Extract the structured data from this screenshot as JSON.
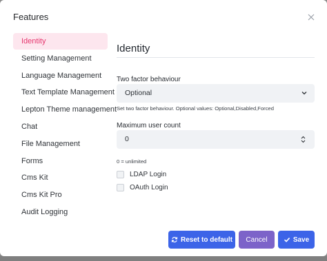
{
  "modal": {
    "title": "Features"
  },
  "nav": {
    "items": [
      {
        "label": "Identity",
        "active": true
      },
      {
        "label": "Setting Management"
      },
      {
        "label": "Language Management"
      },
      {
        "label": "Text Template Management"
      },
      {
        "label": "Lepton Theme management"
      },
      {
        "label": "Chat"
      },
      {
        "label": "File Management"
      },
      {
        "label": "Forms"
      },
      {
        "label": "Cms Kit"
      },
      {
        "label": "Cms Kit Pro"
      },
      {
        "label": "Audit Logging"
      }
    ]
  },
  "section": {
    "title": "Identity",
    "two_factor": {
      "label": "Two factor behaviour",
      "value": "Optional",
      "help": "Set two factor behaviour. Optional values: Optional,Disabled,Forced"
    },
    "max_users": {
      "label": "Maximum user count",
      "value": "0",
      "help": "0 = unlimited"
    },
    "ldap_label": "LDAP Login",
    "oauth_label": "OAuth Login"
  },
  "buttons": {
    "reset_label": "Reset to default",
    "cancel_label": "Cancel",
    "save_label": "Save"
  },
  "colors": {
    "primary": "#3c64e8",
    "secondary": "#7c63c9",
    "active_nav_bg": "#fde6ee",
    "active_nav_text": "#e6366e"
  },
  "icons": {
    "close": "close-icon",
    "select": "chevron-down-icon",
    "spinner": "spinner-arrows-icon",
    "reset": "refresh-icon",
    "save": "check-icon"
  }
}
